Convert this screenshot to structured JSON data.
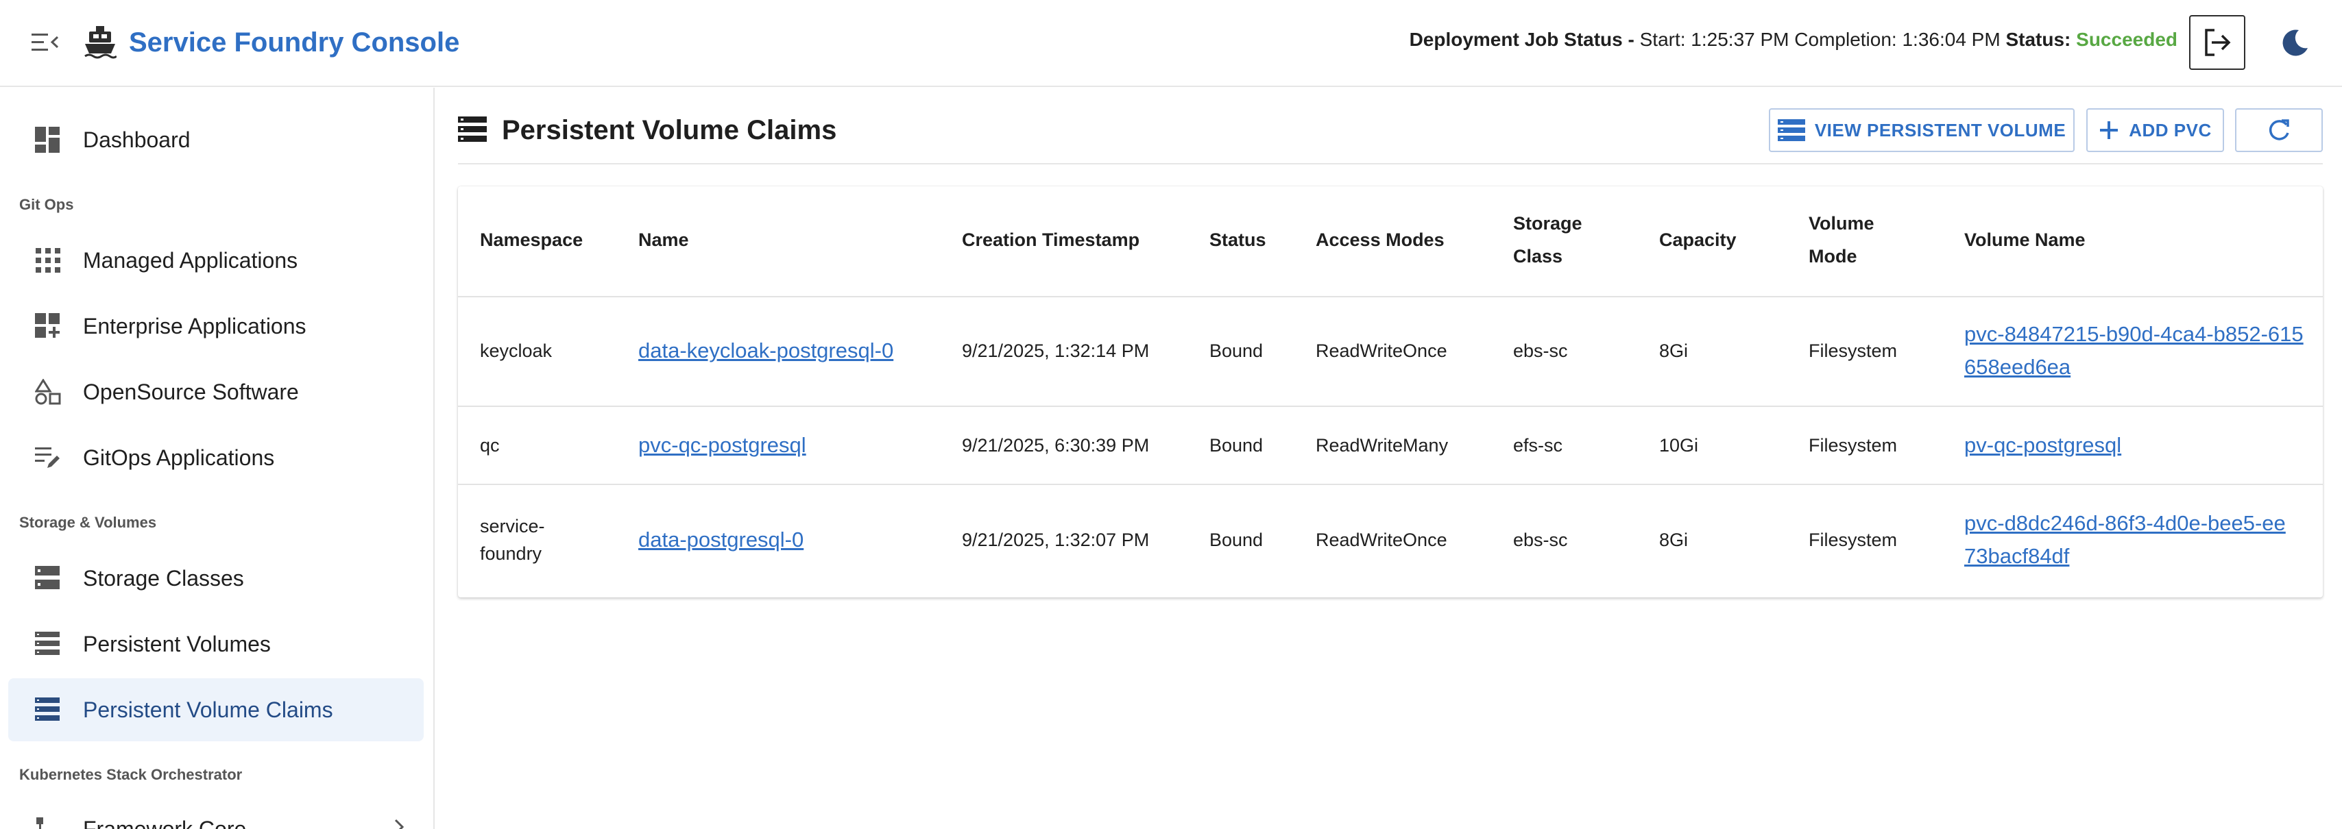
{
  "app": {
    "title": "Service Foundry Console"
  },
  "header": {
    "job_label": "Deployment Job Status -",
    "start_text": "Start: 1:25:37 PM",
    "completion_text": "Completion: 1:36:04 PM",
    "status_label": "Status:",
    "status_value": "Succeeded",
    "status_color": "#58a843"
  },
  "sidebar": {
    "dashboard": "Dashboard",
    "sections": {
      "gitops": "Git Ops",
      "storage": "Storage & Volumes",
      "kso": "Kubernetes Stack Orchestrator"
    },
    "gitops_items": [
      "Managed Applications",
      "Enterprise Applications",
      "OpenSource Software",
      "GitOps Applications"
    ],
    "storage_items": [
      "Storage Classes",
      "Persistent Volumes",
      "Persistent Volume Claims"
    ],
    "kso_items": [
      "Framework Core"
    ]
  },
  "main": {
    "title": "Persistent Volume Claims",
    "buttons": {
      "view_pv": "VIEW PERSISTENT VOLUME",
      "add_pvc": "ADD PVC"
    },
    "table": {
      "headers": [
        "Namespace",
        "Name",
        "Creation Timestamp",
        "Status",
        "Access Modes",
        "Storage Class",
        "Capacity",
        "Volume Mode",
        "Volume Name"
      ],
      "rows": [
        {
          "namespace": "keycloak",
          "name": "data-keycloak-postgresql-0",
          "created": "9/21/2025, 1:32:14 PM",
          "status": "Bound",
          "access": "ReadWriteOnce",
          "storage_class": "ebs-sc",
          "capacity": "8Gi",
          "volume_mode": "Filesystem",
          "volume_name": "pvc-84847215-b90d-4ca4-b852-615658eed6ea"
        },
        {
          "namespace": "qc",
          "name": "pvc-qc-postgresql",
          "created": "9/21/2025, 6:30:39 PM",
          "status": "Bound",
          "access": "ReadWriteMany",
          "storage_class": "efs-sc",
          "capacity": "10Gi",
          "volume_mode": "Filesystem",
          "volume_name": "pv-qc-postgresql"
        },
        {
          "namespace": "service-foundry",
          "name": "data-postgresql-0",
          "created": "9/21/2025, 1:32:07 PM",
          "status": "Bound",
          "access": "ReadWriteOnce",
          "storage_class": "ebs-sc",
          "capacity": "8Gi",
          "volume_mode": "Filesystem",
          "volume_name": "pvc-d8dc246d-86f3-4d0e-bee5-ee73bacf84df"
        }
      ]
    }
  }
}
